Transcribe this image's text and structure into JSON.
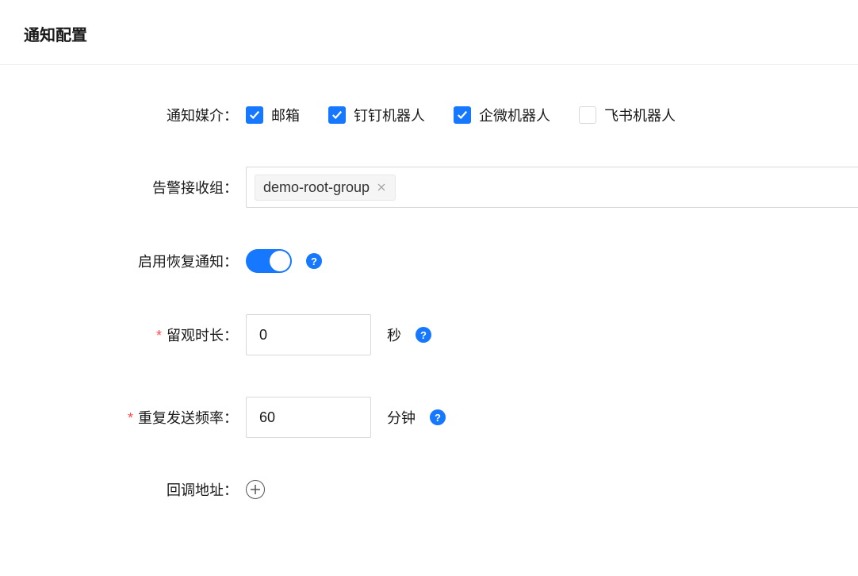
{
  "title": "通知配置",
  "labels": {
    "media": "通知媒介：",
    "group": "告警接收组：",
    "recovery": "启用恢复通知：",
    "observe": "留观时长：",
    "repeat": "重复发送频率：",
    "callback": "回调地址："
  },
  "media_options": [
    {
      "label": "邮箱",
      "checked": true
    },
    {
      "label": "钉钉机器人",
      "checked": true
    },
    {
      "label": "企微机器人",
      "checked": true
    },
    {
      "label": "飞书机器人",
      "checked": false
    }
  ],
  "group_tags": [
    "demo-root-group"
  ],
  "recovery_enabled": true,
  "observe": {
    "value": "0",
    "unit": "秒"
  },
  "repeat": {
    "value": "60",
    "unit": "分钟"
  },
  "icons": {
    "help": "?"
  }
}
